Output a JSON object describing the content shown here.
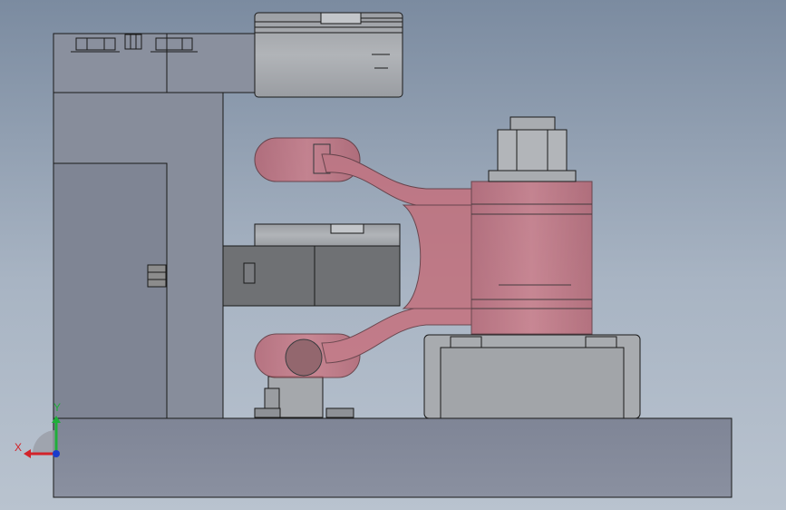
{
  "viewport": {
    "triad": {
      "x_label": "X",
      "y_label": "Y"
    },
    "colors": {
      "background_top": "#7b8ba0",
      "background_bottom": "#b9c3cf",
      "steel_part": "#858b98",
      "steel_part_light": "#9aa0ab",
      "grey_part": "#a4a8ad",
      "dark_part": "#6f7174",
      "highlight_part": "#c5707d",
      "edge": "#1a1a1a",
      "x_axis": "#d2232a",
      "y_axis": "#1fae3a",
      "z_axis": "#1a3ccc"
    }
  }
}
